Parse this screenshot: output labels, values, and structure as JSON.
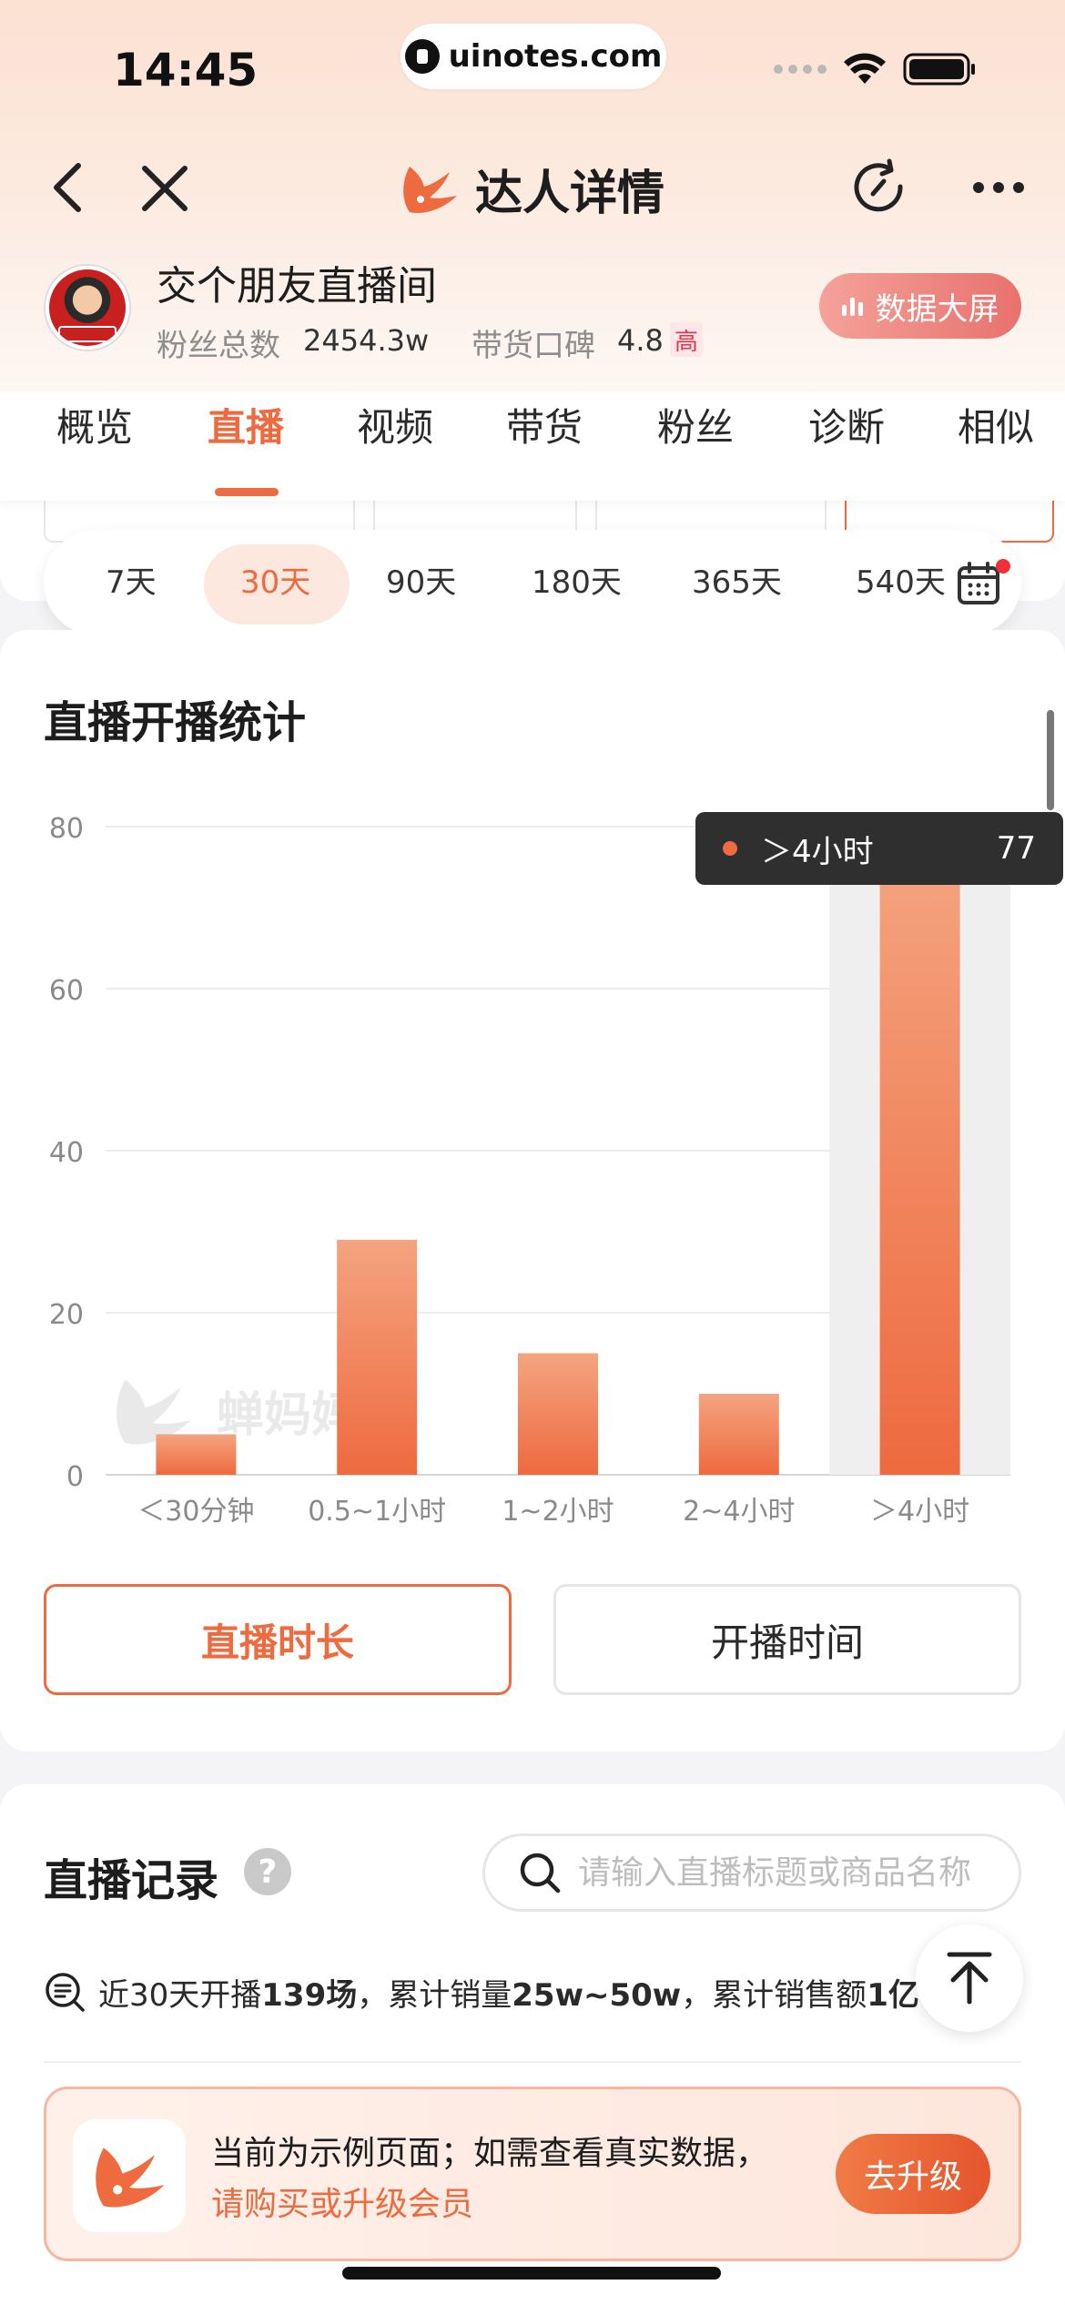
{
  "status_bar": {
    "time": "14:45",
    "url": "uinotes.com"
  },
  "nav": {
    "title": "达人详情"
  },
  "profile": {
    "name": "交个朋友直播间",
    "fans_label": "粉丝总数",
    "fans_value": "2454.3w",
    "rep_label": "带货口碑",
    "rep_value": "4.8",
    "rep_badge": "高",
    "big_screen_label": "数据大屏"
  },
  "tabs": [
    {
      "label": "概览"
    },
    {
      "label": "直播"
    },
    {
      "label": "视频"
    },
    {
      "label": "带货"
    },
    {
      "label": "粉丝"
    },
    {
      "label": "诊断"
    },
    {
      "label": "相似"
    }
  ],
  "active_tab": "直播",
  "date_range": {
    "options": [
      "7天",
      "30天",
      "90天",
      "180天",
      "365天",
      "540天"
    ],
    "selected": "30天"
  },
  "chart_section": {
    "title": "直播开播统计",
    "watermark": "蝉妈妈",
    "tooltip": {
      "label": "＞4小时",
      "value": "77"
    }
  },
  "chart_data": {
    "type": "bar",
    "categories": [
      "＜30分钟",
      "0.5~1小时",
      "1~2小时",
      "2~4小时",
      "＞4小时"
    ],
    "values": [
      5,
      29,
      15,
      10,
      77
    ],
    "ylim": [
      0,
      80
    ],
    "yticks": [
      "0",
      "20",
      "40",
      "60",
      "80"
    ],
    "highlighted_category": "＞4小时",
    "grid": true,
    "bar_color_top": "#f4a480",
    "bar_color_bottom": "#ee6a3f"
  },
  "toggles": {
    "duration_label": "直播时长",
    "start_time_label": "开播时间"
  },
  "records": {
    "title": "直播记录",
    "help": "?",
    "search_placeholder": "请输入直播标题或商品名称",
    "summary": {
      "p1": "近30天开播",
      "count": "139场",
      "p2": "，累计销量",
      "sales": "25w~50w",
      "p3": "，累计销售额",
      "revenue": "1亿+"
    }
  },
  "upgrade": {
    "line1": "当前为示例页面；如需查看真实数据，",
    "line2": "请购买或升级会员",
    "button": "去升级"
  },
  "colors": {
    "accent": "#ee6a3f",
    "tooltip_bg": "#2f2f2f"
  }
}
